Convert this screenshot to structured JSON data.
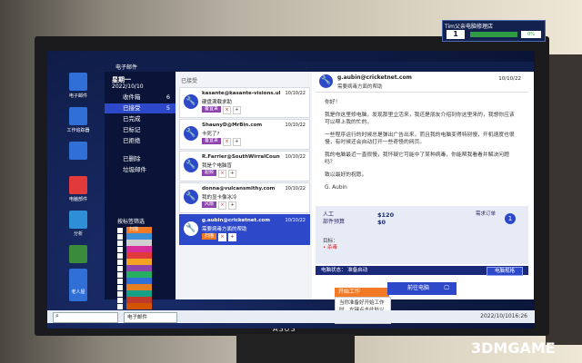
{
  "shop": {
    "title": "Tim父亲电脑修理店",
    "day": "1",
    "progress_pct": "0%"
  },
  "desktop_icons": [
    {
      "label": "电子邮件",
      "color": "#2f6fd6"
    },
    {
      "label": "工作追踪器",
      "color": "#2f6fd6"
    },
    {
      "label": "",
      "color": "#2f6fd6"
    },
    {
      "label": "电脑部件",
      "color": "#e23a3a"
    },
    {
      "label": "分析",
      "color": "#2f8fd6"
    },
    {
      "label": "",
      "color": "#3c8a3c"
    },
    {
      "label": "",
      "color": "#2f6fd6"
    },
    {
      "label": "老人屋",
      "color": "#2f6fd6"
    }
  ],
  "mail": {
    "window_title": "电子邮件",
    "weekday": "星期一",
    "date": "2022/10/10",
    "folders": [
      {
        "label": "收件箱",
        "count": "6"
      },
      {
        "label": "已接受",
        "count": "5"
      },
      {
        "label": "已完成",
        "count": ""
      },
      {
        "label": "已标记",
        "count": ""
      },
      {
        "label": "已拒绝",
        "count": ""
      },
      {
        "label": "已删除",
        "count": ""
      },
      {
        "label": "垃圾邮件",
        "count": ""
      }
    ],
    "spam_title": "按标签筛选",
    "spam_tags": [
      {
        "label": "扫描",
        "color": "#f27a24"
      },
      {
        "label": "",
        "color": "#3a8fd6"
      },
      {
        "label": "",
        "color": "#d0d0d0"
      },
      {
        "label": "",
        "color": "#d62e9a"
      },
      {
        "label": "",
        "color": "#e23a3a"
      },
      {
        "label": "",
        "color": "#f2a324"
      },
      {
        "label": "",
        "color": "#8e44ad"
      },
      {
        "label": "",
        "color": "#27ae60"
      },
      {
        "label": "",
        "color": "#2f6fd6"
      },
      {
        "label": "",
        "color": "#e67e22"
      },
      {
        "label": "",
        "color": "#16a085"
      },
      {
        "label": "",
        "color": "#c0392b"
      },
      {
        "label": "",
        "color": "#d35400"
      }
    ],
    "list_title": "已接受",
    "messages": [
      {
        "from": "kasante@kasante-visions.uk",
        "date": "10/10/22",
        "subject": "硬盘满载求助",
        "tags": [
          {
            "label": "备宜来",
            "color": "#8e44ad"
          }
        ]
      },
      {
        "from": "ShaunyD@MrBin.com",
        "date": "10/10/22",
        "subject": "卡死了?",
        "tags": [
          {
            "label": "备宜来",
            "color": "#8e44ad"
          }
        ]
      },
      {
        "from": "R.Farrier@SouthWirralCountr...",
        "date": "10/10/22",
        "subject": "我是个电脑盲",
        "tags": [
          {
            "label": "超频",
            "color": "#8e44ad"
          }
        ]
      },
      {
        "from": "donna@vulcansmithy.com",
        "date": "10/10/22",
        "subject": "我的显卡像冰冷",
        "tags": [
          {
            "label": "风扇",
            "color": "#8e44ad"
          }
        ]
      },
      {
        "from": "g.aubin@cricketnet.com",
        "date": "10/10/22",
        "subject": "需要病毒方面的帮助",
        "tags": [
          {
            "label": "扫描",
            "color": "#f27a24"
          }
        ]
      }
    ],
    "read": {
      "from": "g.aubin@cricketnet.com",
      "subject": "需要病毒方面的帮助",
      "date": "10/10/22",
      "body": [
        "你好！",
        "我是你这里修电脑，发现那里立活来，我还是朋友介绍到你这里来的，我想你应该可以帮上我的忙的。",
        "一些程序运行的时候总是弹出广告出来，而且我的电脑变得特别慢，开机速度也很慢，有时候还会自动打开一些奇怪的网页。",
        "我的电脑最近一直很慢，我怀疑它可能中了某种病毒，你能帮我看看并解决问题吗？",
        "致以最好的祝愿。",
        "G. Aubin"
      ],
      "job": {
        "labor_label": "人工",
        "labor": "$120",
        "parts_label": "部件预算",
        "parts": "$0",
        "jobs_label": "需求订单",
        "jobs_count": "1"
      },
      "goal_label": "目标：",
      "goal_value": "• 杀毒",
      "status_label": "电脑状态：",
      "status_value": "准备启动",
      "status_button": "电脑规格"
    },
    "tip_title": "开始工作",
    "tip_text": "当你准备好开始工作时，左键点击此处以前往电脑。",
    "goto_button": "前往电脑"
  },
  "taskbar": {
    "mail_label": "电子邮件",
    "time": "2022/10/1016:26"
  },
  "monitor_brand": "ASUS",
  "watermark": "3DMGAME"
}
